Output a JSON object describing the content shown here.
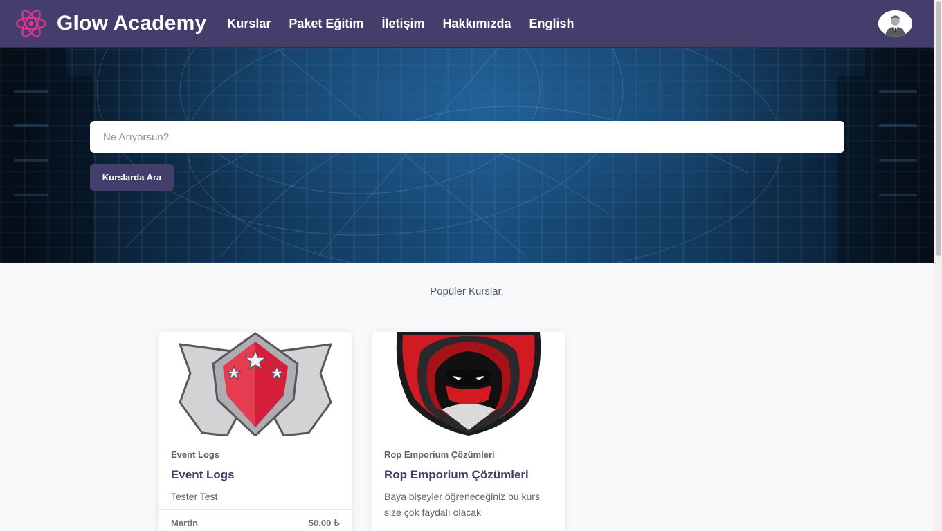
{
  "brand": {
    "name": "Glow Academy",
    "logo_icon": "atom-icon"
  },
  "nav": {
    "items": [
      {
        "label": "Kurslar"
      },
      {
        "label": "Paket Eğitim"
      },
      {
        "label": "İletişim"
      },
      {
        "label": "Hakkımızda"
      },
      {
        "label": "English"
      }
    ]
  },
  "user": {
    "avatar_icon": "user-avatar-icon"
  },
  "hero": {
    "search_placeholder": "Ne Arıyorsun?",
    "search_value": "",
    "search_button_label": "Kurslarda Ara"
  },
  "popular": {
    "title": "Popüler Kurslar.",
    "courses": [
      {
        "category": "Event Logs",
        "title": "Event Logs",
        "description": "Tester Test",
        "instructor": "Martin",
        "price": "50.00 ₺",
        "image_icon": "star-shield-emblem-icon"
      },
      {
        "category": "Rop Emporium Çözümleri",
        "title": "Rop Emporium Çözümleri",
        "description": "Baya bişeyler öğreneceğiniz bu kurs size çok faydalı olacak",
        "instructor": "",
        "price": "",
        "image_icon": "hooded-ninja-shield-icon"
      }
    ]
  },
  "colors": {
    "navbar": "#433e6c",
    "accent": "#433e6c",
    "page_background": "#f8f9fb",
    "logo": "#e0338f"
  }
}
